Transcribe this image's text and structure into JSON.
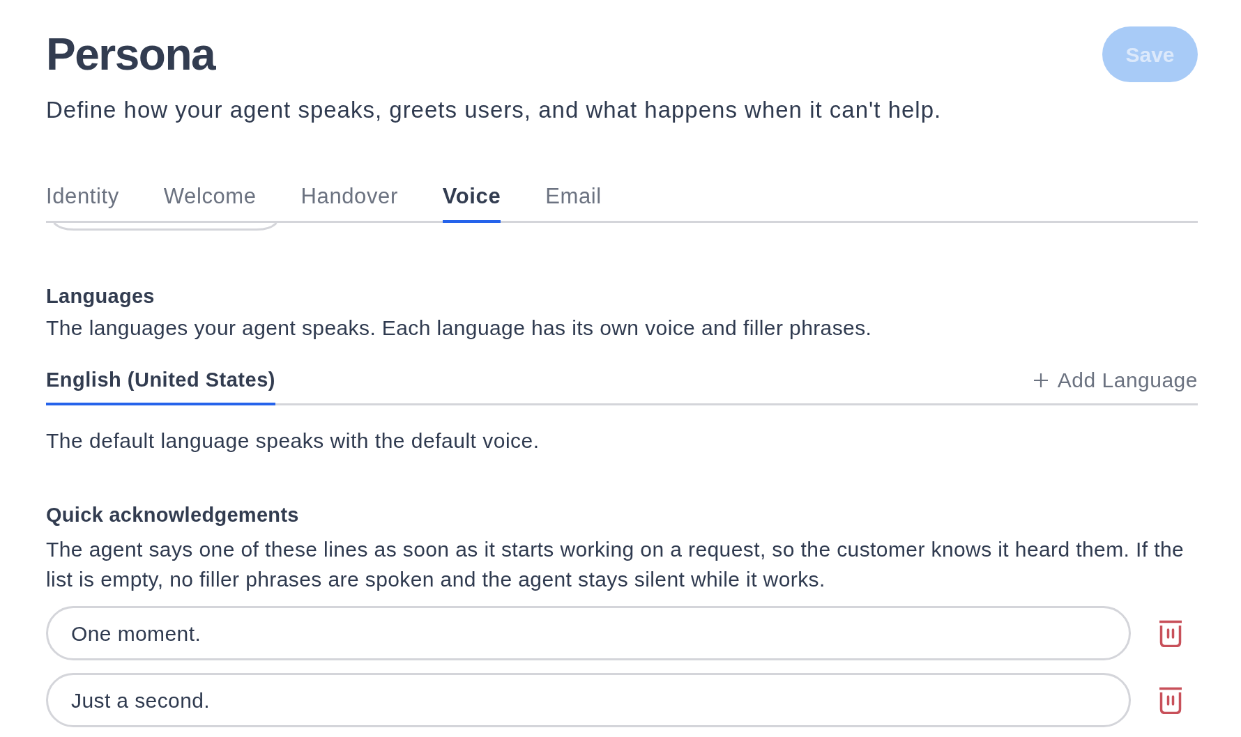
{
  "header": {
    "title": "Persona",
    "subtitle": "Define how your agent speaks, greets users, and what happens when it can't help.",
    "save_button": {
      "label": "Save",
      "disabled": true
    }
  },
  "tabs": [
    {
      "label": "Identity",
      "selected": false
    },
    {
      "label": "Welcome",
      "selected": false
    },
    {
      "label": "Handover",
      "selected": false
    },
    {
      "label": "Voice",
      "selected": true
    },
    {
      "label": "Email",
      "selected": false
    }
  ],
  "languages": {
    "heading": "Languages",
    "description": "The languages your agent speaks. Each language has its own voice and filler phrases.",
    "tabs": [
      {
        "label": "English (United States)",
        "selected": true
      }
    ],
    "add_button": "Add Language",
    "note": "The default language speaks with the default voice."
  },
  "quick_acknowledgements": {
    "heading": "Quick acknowledgements",
    "description": "The agent says one of these lines as soon as it starts working on a request, so the customer knows it heard them. If the list is empty, no filler phrases are spoken and the agent stays silent while it works.",
    "phrases": [
      {
        "value": "One moment."
      },
      {
        "value": "Just a second."
      }
    ]
  }
}
